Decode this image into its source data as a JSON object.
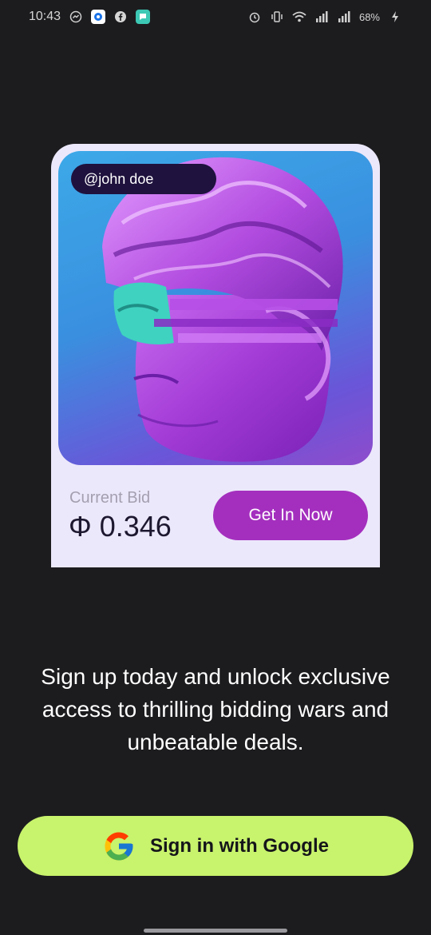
{
  "status_bar": {
    "time": "10:43",
    "battery": "68%",
    "signal_1": "4G",
    "signal_2": "4G"
  },
  "card": {
    "username": "@john doe",
    "bid_label": "Current Bid",
    "currency_symbol": "Φ",
    "bid_amount": "0.346",
    "cta_label": "Get In Now"
  },
  "headline": "Sign up today and unlock exclusive access to thrilling bidding wars and unbeatable deals.",
  "google_button": {
    "label": "Sign in with Google"
  },
  "colors": {
    "background": "#1c1c1f",
    "card_bg": "#ece8fb",
    "cta": "#a42fbe",
    "google_button": "#c8f36c",
    "username_pill": "#1f123e"
  }
}
